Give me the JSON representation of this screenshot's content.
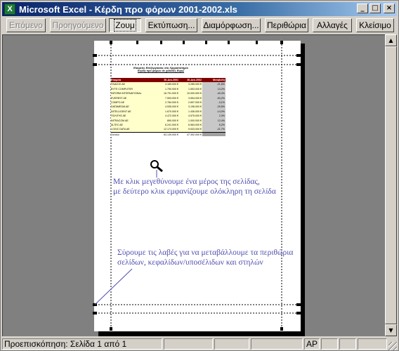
{
  "window": {
    "title": "Microsoft Excel - Κέρδη προ φόρων 2001-2002.xls",
    "minimize_icon": "minimize-icon",
    "maximize_icon": "maximize-icon",
    "close_icon": "close-icon"
  },
  "toolbar": {
    "next": "Επόμενο",
    "previous": "Προηγούμενο",
    "zoom": "Ζουμ",
    "print": "Εκτύπωση...",
    "setup": "Διαμόρφωση...",
    "margins": "Περιθώρια",
    "page_break": "Αλλαγές",
    "close": "Κλείσιμο"
  },
  "sheet": {
    "title_line1": "Εταιρείες Επεξεργασίας στο Χρηματιστήριο",
    "title_line2": "Κέρδη προ φόρων σε χιλιάδες Ευρώ",
    "columns": [
      "Εταιρεία",
      "30-Δεκ-2001",
      "30-Δεκ-2002",
      "Μεταβολή"
    ],
    "rows": [
      [
        "ΠΛΑΙΣΙΟ ΑΕ",
        "4.189.000 €",
        "3.285.000 €",
        "-21,6%"
      ],
      [
        "BYTE COMPUTER",
        "1.790.000 €",
        "1.553.000 €",
        "13,2%"
      ],
      [
        "INFORM INTERNATIONAL",
        "16.791.000 €",
        "10.000.000 €",
        "-40,4%"
      ],
      [
        "EVEREST AE",
        "7.593.000 €",
        "3.554.000 €",
        "-53,2%"
      ],
      [
        "COMPO AE",
        "2.784.000 €",
        "2.697.000 €",
        "-3,1%"
      ],
      [
        "DATAMEDIA AE",
        "4.535.000 €",
        "3.196.000 €",
        "-29,5%"
      ],
      [
        "INTELLIGENT AE",
        "1.670.000 €",
        "1.436.000 €",
        "-14,0%"
      ],
      [
        "ΠΟΛΙΤΗΣ ΑΕ",
        "4.472.000 €",
        "4.575.000 €",
        "2,3%"
      ],
      [
        "INTRACOM AE",
        "890.000 €",
        "1.000.000 €",
        "12,4%"
      ],
      [
        "ALTEC AE",
        "6.241.000 €",
        "6.563.000 €",
        "5,2%"
      ],
      [
        "LOGIC DATA AE",
        "12.174.000 €",
        "9.533.000 €",
        "-21,7%"
      ]
    ],
    "total": [
      "Σύνολο",
      "63.139.000 €",
      "47.392.000 €",
      ""
    ]
  },
  "annotations": {
    "zoom_line1": "Με κλικ μεγεθύνουμε ένα μέρος της σελίδας,",
    "zoom_line2": "με δεύτερο κλικ εμφανίζουμε ολόκληρη τη σελίδα",
    "drag_line1": "Σύρουμε τις λαβές για να μεταβάλλουμε τα περιθώρια",
    "drag_line2": "σελίδων, κεφαλίδων/υποσέλιδων και στηλών"
  },
  "icons": {
    "app": "excel-app-icon",
    "zoom": "magnifier-icon"
  },
  "statusbar": {
    "text": "Προεπισκόπηση: Σελίδα 1 από 1",
    "indicator": "AP"
  },
  "colors": {
    "header_fill": "#800000",
    "row_fill": "#ffffcc",
    "annotation": "#4f4fb0"
  }
}
